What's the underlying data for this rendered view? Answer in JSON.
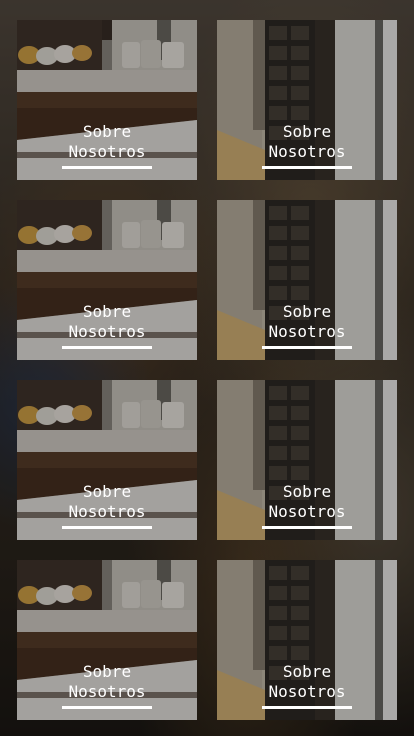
{
  "cards": [
    {
      "line1": "Sobre",
      "line2": "Nosotros",
      "photo": "bedroom-photo"
    },
    {
      "line1": "Sobre",
      "line2": "Nosotros",
      "photo": "closet-photo"
    },
    {
      "line1": "Sobre",
      "line2": "Nosotros",
      "photo": "bedroom-photo"
    },
    {
      "line1": "Sobre",
      "line2": "Nosotros",
      "photo": "closet-photo"
    },
    {
      "line1": "Sobre",
      "line2": "Nosotros",
      "photo": "bedroom-photo"
    },
    {
      "line1": "Sobre",
      "line2": "Nosotros",
      "photo": "closet-photo"
    },
    {
      "line1": "Sobre",
      "line2": "Nosotros",
      "photo": "bedroom-photo"
    },
    {
      "line1": "Sobre",
      "line2": "Nosotros",
      "photo": "closet-photo"
    }
  ],
  "colors": {
    "caption_text": "#ffffff",
    "underline": "#ffffff"
  }
}
